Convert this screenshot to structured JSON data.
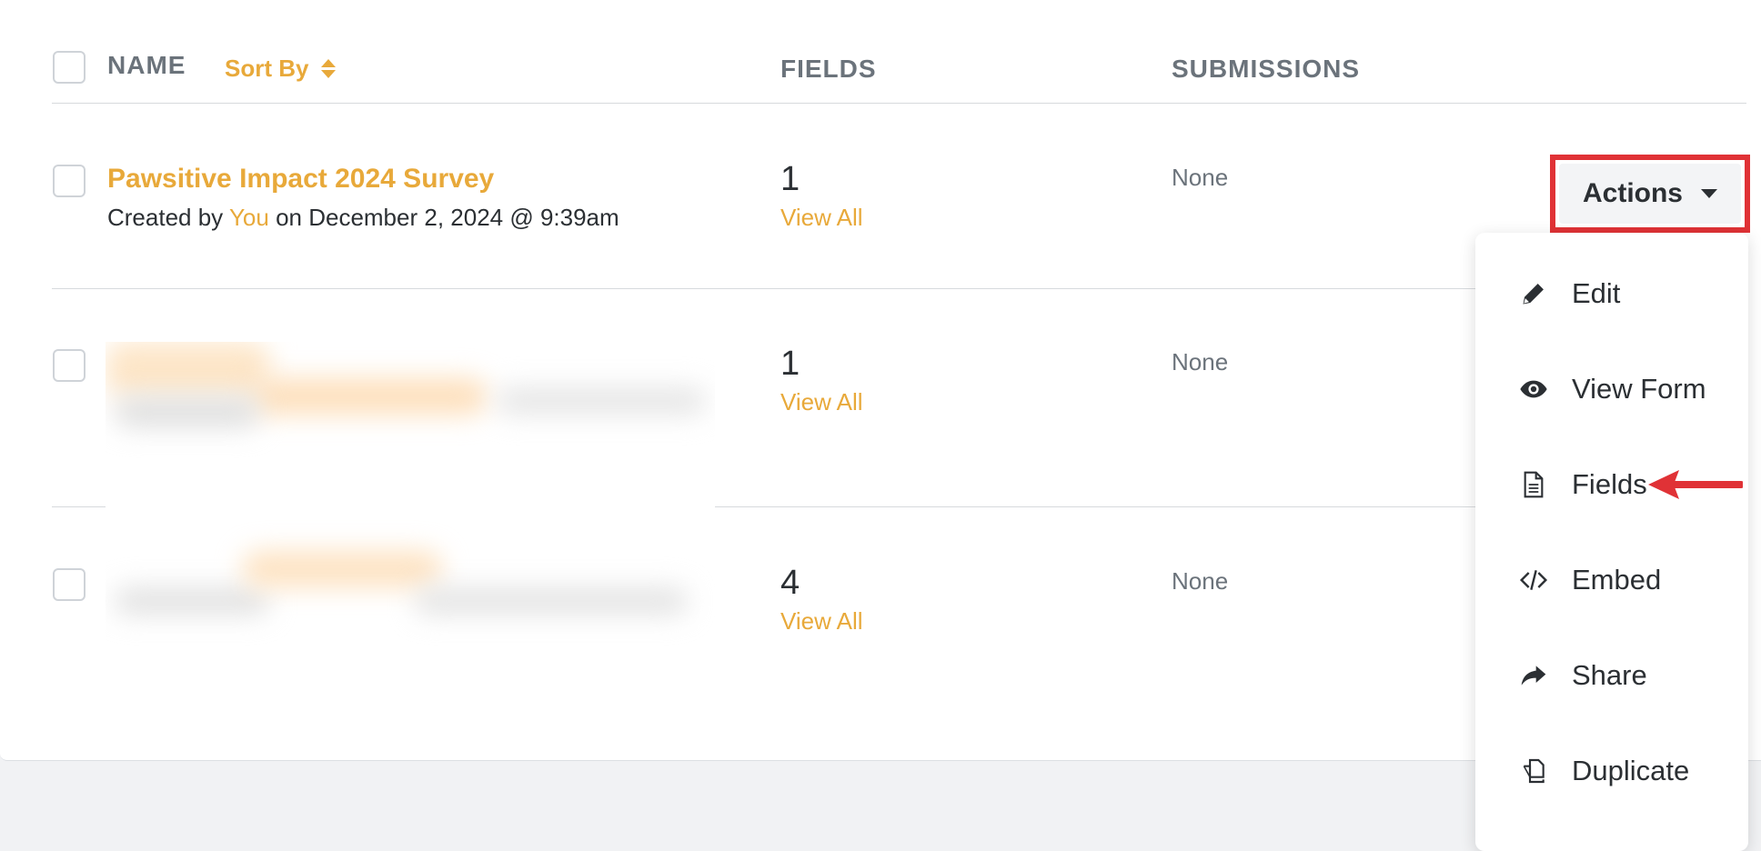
{
  "table": {
    "headers": {
      "name": "NAME",
      "sort_by": "Sort By",
      "fields": "FIELDS",
      "submissions": "SUBMISSIONS"
    },
    "rows": [
      {
        "title": "Pawsitive Impact 2024 Survey",
        "created_prefix": "Created by",
        "created_by": "You",
        "created_suffix": "on December 2, 2024 @ 9:39am",
        "field_count": "1",
        "view_all": "View All",
        "submissions": "None"
      },
      {
        "field_count": "1",
        "view_all": "View All",
        "submissions": "None"
      },
      {
        "field_count": "4",
        "view_all": "View All",
        "submissions": "None"
      }
    ]
  },
  "actions": {
    "label": "Actions",
    "menu": [
      {
        "label": "Edit",
        "icon": "pencil-icon"
      },
      {
        "label": "View Form",
        "icon": "eye-icon"
      },
      {
        "label": "Fields",
        "icon": "document-icon"
      },
      {
        "label": "Embed",
        "icon": "code-icon"
      },
      {
        "label": "Share",
        "icon": "share-icon"
      },
      {
        "label": "Duplicate",
        "icon": "duplicate-icon"
      }
    ]
  },
  "colors": {
    "accent": "#e8a93a",
    "highlight": "#e03236",
    "text": "#2b2f33",
    "muted": "#6b737b"
  }
}
